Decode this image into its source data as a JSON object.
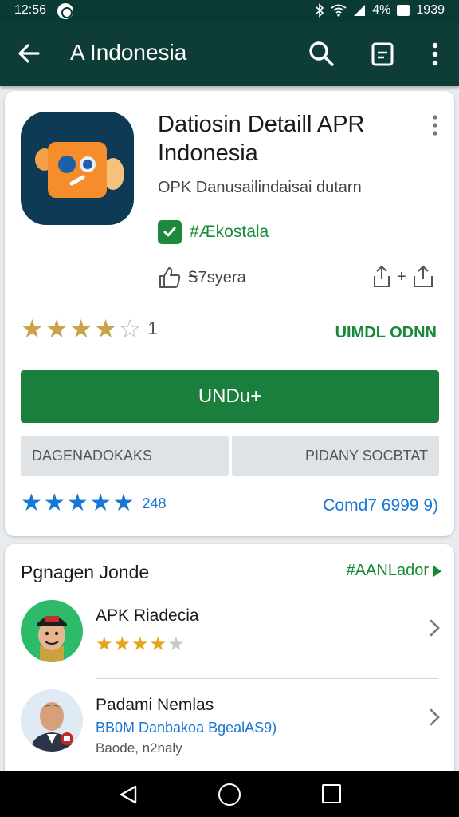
{
  "status_bar": {
    "time": "12:56",
    "battery_pct": "4%",
    "clock_right": "1939"
  },
  "app_bar": {
    "title": "A Indonesia"
  },
  "app": {
    "title": "Datiosin Detaill APR Indonesia",
    "subtitle": "OPK Danusailindaisai dutarn",
    "verified_label": "#Ækostala",
    "like_label": "Ꭶ7syera",
    "share_plus": "+",
    "rating_stars": 3.5,
    "rating_count": "1",
    "downloads_label": "UIMDL ODNN",
    "install_label": "UNDu+",
    "secondary_left": "DAGENADOKAKS",
    "secondary_right": "PIDANY SOCBTAT",
    "blue_rating_count": "248",
    "blue_link": "Comd7 6999 9)"
  },
  "related": {
    "title": "Pgnagen Jonde",
    "link_label": "#AANLador",
    "items": [
      {
        "name": "APK Riadecia",
        "stars": 3.5
      },
      {
        "name": "Padami Nemlas",
        "sub1": "BB0M Danbakoa BgealAS9)",
        "sub2": "Baode, n2naly"
      }
    ]
  },
  "colors": {
    "header": "#0d3d36",
    "accent_green": "#1a7f3c",
    "link_blue": "#1677d4",
    "star_gold": "#c9a34a"
  },
  "icons": [
    "back-arrow-icon",
    "search-icon",
    "menu-box-icon",
    "overflow-icon",
    "check-icon",
    "like-icon",
    "share-icon",
    "chevron-right-icon"
  ]
}
